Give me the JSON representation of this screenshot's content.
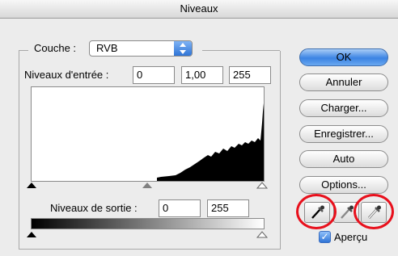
{
  "window": {
    "title": "Niveaux"
  },
  "channel": {
    "label": "Couche :",
    "value": "RVB",
    "arrow": "▲\n▼"
  },
  "input_levels": {
    "label": "Niveaux d'entrée :",
    "black": "0",
    "gamma": "1,00",
    "white": "255"
  },
  "output_levels": {
    "label": "Niveaux de sortie :",
    "black": "0",
    "white": "255"
  },
  "buttons": {
    "ok": "OK",
    "cancel": "Annuler",
    "load": "Charger...",
    "save": "Enregistrer...",
    "auto": "Auto",
    "options": "Options..."
  },
  "eyedroppers": [
    "black-point-eyedropper-icon",
    "gray-point-eyedropper-icon",
    "white-point-eyedropper-icon"
  ],
  "preview": {
    "label": "Aperçu",
    "checked": true,
    "check_glyph": "✓"
  },
  "colors": {
    "accent": "#3b83e3",
    "highlight": "#e8101c"
  }
}
